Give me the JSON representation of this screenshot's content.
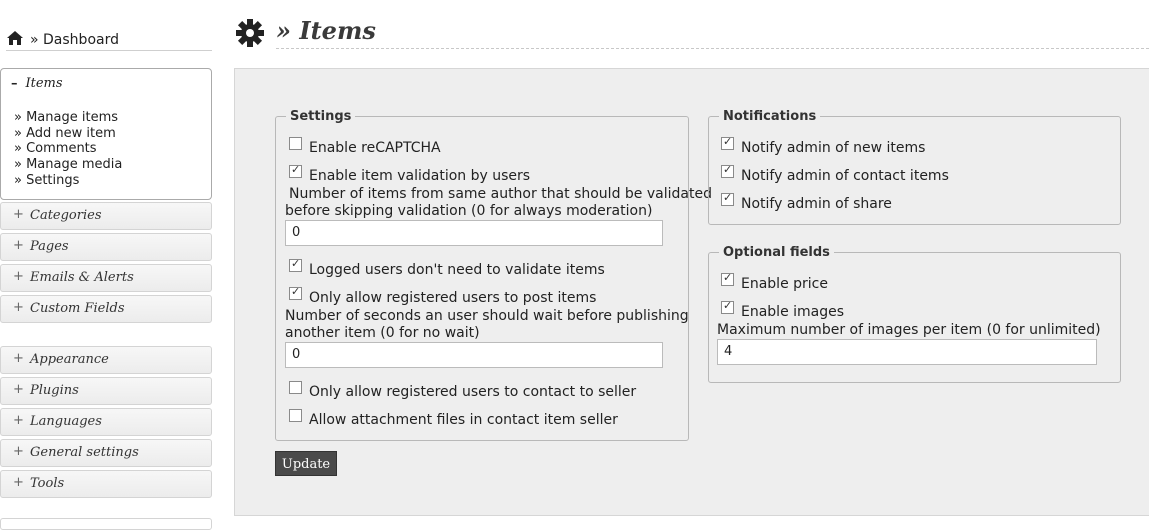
{
  "breadcrumb": {
    "home_icon": "home-icon",
    "separator": "»",
    "label": "Dashboard"
  },
  "page": {
    "title_prefix": "»",
    "title": "Items",
    "icon": "gear-icon"
  },
  "sidebar": {
    "open_section": {
      "toggle": "–",
      "label": "Items",
      "links": [
        "» Manage items",
        "» Add new item",
        "» Comments",
        "» Manage media",
        "» Settings"
      ]
    },
    "sections": [
      {
        "toggle": "+",
        "label": "Categories"
      },
      {
        "toggle": "+",
        "label": "Pages"
      },
      {
        "toggle": "+",
        "label": "Emails & Alerts"
      },
      {
        "toggle": "+",
        "label": "Custom Fields"
      },
      {
        "toggle": "+",
        "label": "Appearance"
      },
      {
        "toggle": "+",
        "label": "Plugins"
      },
      {
        "toggle": "+",
        "label": "Languages"
      },
      {
        "toggle": "+",
        "label": "General settings"
      },
      {
        "toggle": "+",
        "label": "Tools"
      }
    ]
  },
  "settings": {
    "legend": "Settings",
    "enable_recaptcha": {
      "label": "Enable reCAPTCHA",
      "checked": false
    },
    "enable_validation": {
      "label": "Enable item validation by users",
      "checked": true
    },
    "validation_count_label_1": "Number of items from same author that should be validated",
    "validation_count_label_2": "before skipping validation (0 for always moderation)",
    "validation_count_value": "0",
    "logged_no_validate": {
      "label": "Logged users don't need to validate items",
      "checked": true
    },
    "only_registered_post": {
      "label": "Only allow registered users to post items",
      "checked": true
    },
    "wait_seconds_label_1": "Number of seconds an user should wait before publishing",
    "wait_seconds_label_2": "another item (0 for no wait)",
    "wait_seconds_value": "0",
    "only_registered_contact": {
      "label": "Only allow registered users to contact to seller",
      "checked": false
    },
    "allow_attachments": {
      "label": "Allow attachment files in contact item seller",
      "checked": false
    }
  },
  "notifications": {
    "legend": "Notifications",
    "new_items": {
      "label": "Notify admin of new items",
      "checked": true
    },
    "contact_items": {
      "label": "Notify admin of contact items",
      "checked": true
    },
    "share": {
      "label": "Notify admin of share",
      "checked": true
    }
  },
  "optional_fields": {
    "legend": "Optional fields",
    "enable_price": {
      "label": "Enable price",
      "checked": true
    },
    "enable_images": {
      "label": "Enable images",
      "checked": true
    },
    "max_images_label": "Maximum number of images per item (0 for unlimited)",
    "max_images_value": "4"
  },
  "actions": {
    "update_label": "Update"
  },
  "colors": {
    "panel_bg": "#eeeeee",
    "button_bg": "#4a4a4a"
  }
}
